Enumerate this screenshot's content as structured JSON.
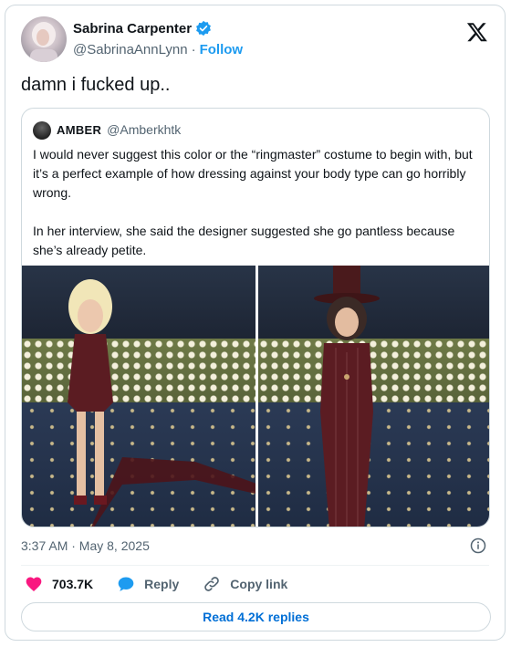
{
  "author": {
    "name": "Sabrina Carpenter",
    "handle": "@SabrinaAnnLynn",
    "separator": "·",
    "follow_label": "Follow"
  },
  "tweet": {
    "text": "damn i fucked up.."
  },
  "quoted_tweet": {
    "name": "AMBER",
    "handle": "@Amberkhtk",
    "paragraphs": [
      "I would never suggest this color or the “ringmaster” costume to begin with, but it’s a perfect example of how dressing against your body type can go horribly wrong.",
      "In her interview, she said the designer suggested she go pantless because she’s already petite."
    ]
  },
  "meta": {
    "timestamp": "3:37 AM · May 8, 2025"
  },
  "actions": {
    "likes": "703.7K",
    "reply_label": "Reply",
    "copy_label": "Copy link"
  },
  "read_replies_label": "Read 4.2K replies",
  "colors": {
    "accent": "#1d9bf0",
    "like": "#f91880",
    "link": "#006fd6",
    "muted": "#536471"
  },
  "icons": [
    "verified-badge-icon",
    "x-logo-icon",
    "info-icon",
    "heart-icon",
    "reply-bubble-icon",
    "link-icon"
  ]
}
